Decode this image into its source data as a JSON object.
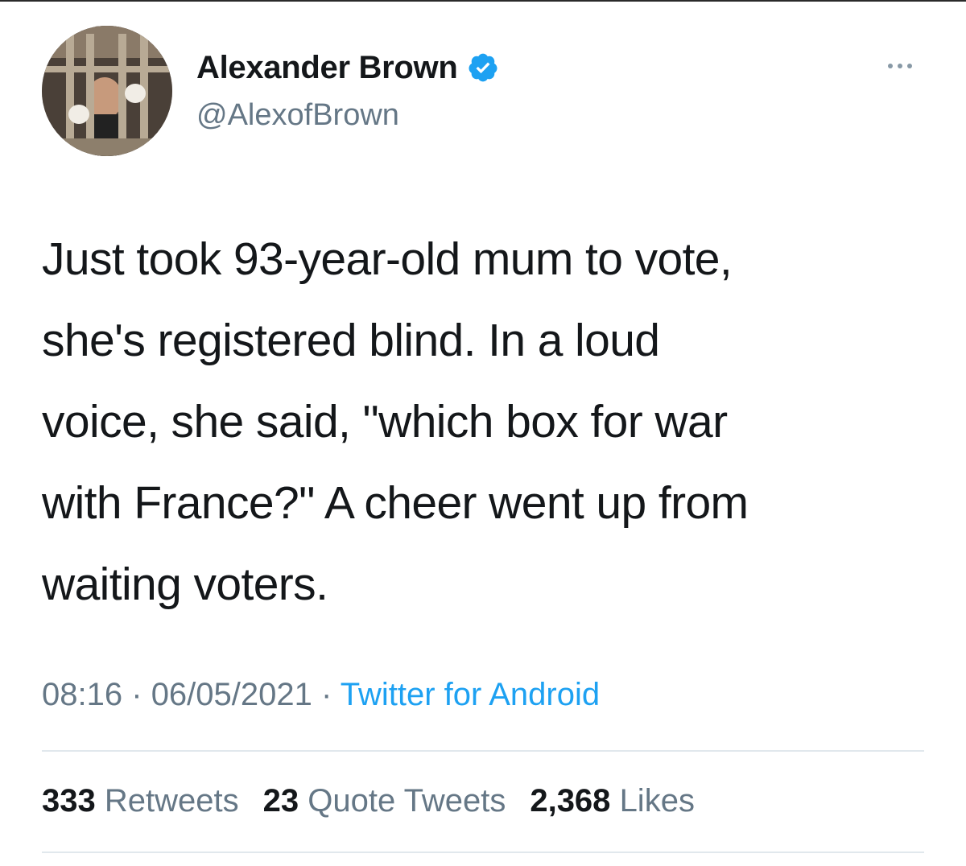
{
  "author": {
    "display_name": "Alexander Brown",
    "handle": "@AlexofBrown",
    "verified": true
  },
  "tweet": {
    "text": "Just took 93-year-old mum to vote, she's registered blind. In a loud voice, she said, \"which box for war with France?\" A cheer went up from waiting voters.",
    "lines": [
      "Just took 93-year-old mum to vote,",
      "she's registered blind. In a loud",
      "voice, she said, \"which box for war",
      "with France?\" A cheer went up from",
      "waiting voters."
    ]
  },
  "meta": {
    "time": "08:16",
    "separator": "·",
    "date": "06/05/2021",
    "source": "Twitter for Android"
  },
  "stats": {
    "retweets_count": "333",
    "retweets_label": "Retweets",
    "quotes_count": "23",
    "quotes_label": "Quote Tweets",
    "likes_count": "2,368",
    "likes_label": "Likes"
  },
  "icons": {
    "verified": "verified-badge-icon",
    "more": "more-options-icon"
  },
  "colors": {
    "accent": "#1da1f2",
    "secondary_text": "#657786",
    "primary_text": "#14171a",
    "divider": "#e1e8ed"
  }
}
